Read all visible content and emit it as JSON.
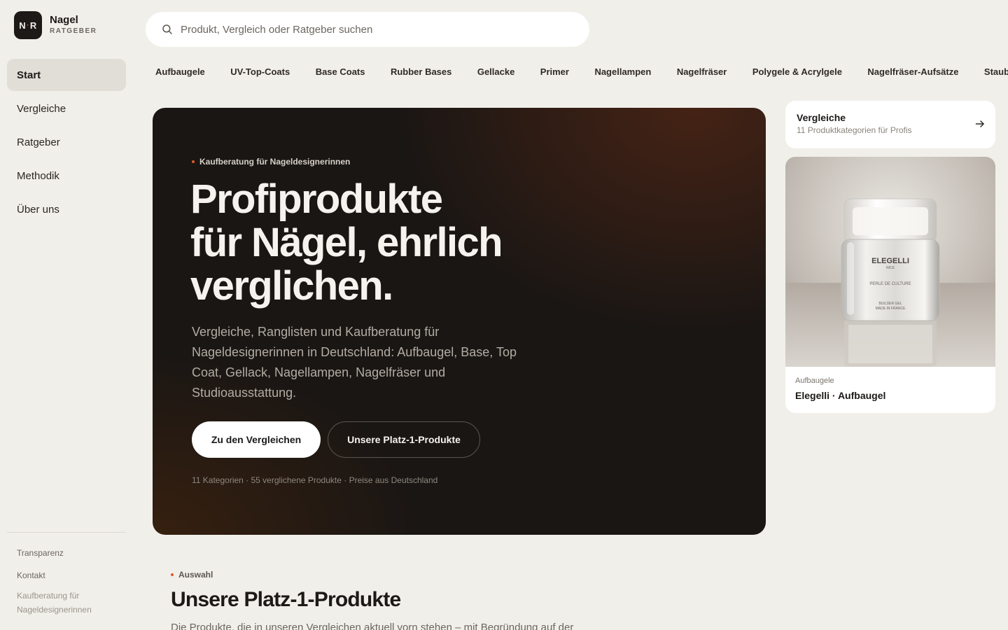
{
  "brand": {
    "logo_left": "N",
    "logo_right": "R",
    "name": "Nagel",
    "sub": "RATGEBER"
  },
  "nav": {
    "items": [
      {
        "label": "Start",
        "active": true
      },
      {
        "label": "Vergleiche",
        "active": false
      },
      {
        "label": "Ratgeber",
        "active": false
      },
      {
        "label": "Methodik",
        "active": false
      },
      {
        "label": "Über uns",
        "active": false
      }
    ]
  },
  "sidebar_footer": {
    "transparency": "Transparenz",
    "contact": "Kontakt",
    "note": "Kaufberatung für Nageldesignerinnen"
  },
  "search": {
    "placeholder": "Produkt, Vergleich oder Ratgeber suchen",
    "value": "",
    "icon": "search-icon"
  },
  "categories": [
    "Aufbaugele",
    "UV-Top-Coats",
    "Base Coats",
    "Rubber Bases",
    "Gellacke",
    "Primer",
    "Nagellampen",
    "Nagelfräser",
    "Polygele & Acrylgele",
    "Nagelfräser-Aufsätze",
    "Staubabs"
  ],
  "hero": {
    "eyebrow": "Kaufberatung für Nageldesignerinnen",
    "title_lines": [
      "Profiprodukte",
      "für Nägel, ehrlich",
      "verglichen."
    ],
    "description": "Vergleiche, Ranglisten und Kaufberatung für Nageldesignerinnen in Deutschland: Aufbaugel, Base, Top Coat, Gellack, Nagellampen, Nagelfräser und Studioausstattung.",
    "primary_button": "Zu den Vergleichen",
    "secondary_button": "Unsere Platz-1-Produkte",
    "meta": "11 Kategorien · 55 verglichene Produkte · Preise aus Deutschland"
  },
  "compare_card": {
    "title": "Vergleiche",
    "subtitle": "11 Produktkategorien für Profis",
    "icon": "arrow-right-icon"
  },
  "product_card": {
    "category": "Aufbaugele",
    "name": "Elegelli · Aufbaugel",
    "jar_brand": "ELEGELLI",
    "jar_city": "NICE",
    "jar_line": "PERLE DE CULTURE",
    "jar_type": "BUILDER GEL",
    "jar_origin": "MADE IN FRANCE"
  },
  "section": {
    "eyebrow": "Auswahl",
    "title": "Unsere Platz-1-Produkte",
    "description": "Die Produkte, die in unseren Vergleichen aktuell vorn stehen – mit Begründung auf der"
  },
  "colors": {
    "accent": "#e05a2b",
    "hero_bg": "#1a1614",
    "page_bg": "#f1efea"
  }
}
